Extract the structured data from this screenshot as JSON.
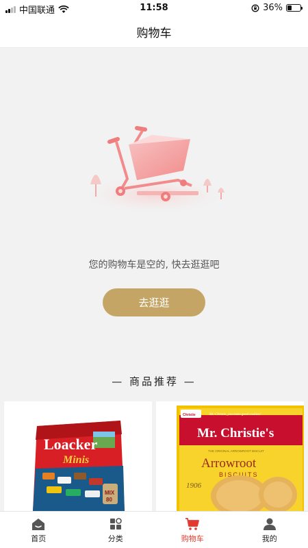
{
  "status_bar": {
    "carrier": "中国联通",
    "time": "11:58",
    "battery_percent": "36%",
    "icons": [
      "signal-icon",
      "wifi-icon",
      "orientation-lock-icon",
      "battery-icon"
    ]
  },
  "nav": {
    "title": "购物车"
  },
  "empty_cart": {
    "message": "您的购物车是空的, 快去逛逛吧",
    "button_label": "去逛逛",
    "illustration": "shopping-cart-icon"
  },
  "recommend": {
    "title": "— 商品推荐 —",
    "products": [
      {
        "brand": "Loacker",
        "subtitle": "Minis",
        "badge": "MIX",
        "count": "80"
      },
      {
        "brand_tag": "Christie",
        "tagline": "Mr. Christie, you make good cookies!",
        "brand": "Mr. Christie's",
        "subtitle": "THE ORIGINAL ARROWROOT BISCUIT",
        "name": "Arrowroot",
        "name_sub": "BISCUITS",
        "year": "1906"
      }
    ]
  },
  "tabs": [
    {
      "label": "首页",
      "icon": "home-icon",
      "active": false
    },
    {
      "label": "分类",
      "icon": "category-icon",
      "active": false
    },
    {
      "label": "购物车",
      "icon": "cart-icon",
      "active": true
    },
    {
      "label": "我的",
      "icon": "user-icon",
      "active": false
    }
  ],
  "colors": {
    "accent": "#c4a566",
    "active_tab": "#e23a2e",
    "background": "#f2f2f2"
  }
}
